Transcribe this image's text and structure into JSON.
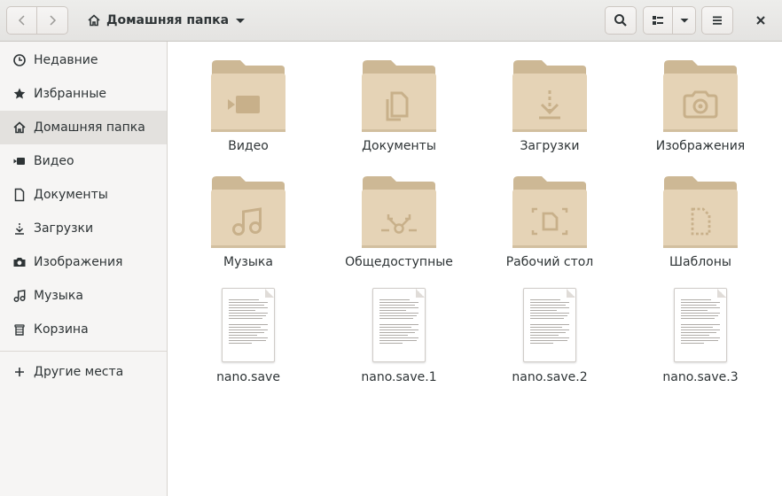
{
  "header": {
    "location_label": "Домашняя папка"
  },
  "sidebar": {
    "items": [
      {
        "label": "Недавние",
        "icon": "clock-icon"
      },
      {
        "label": "Избранные",
        "icon": "star-icon"
      },
      {
        "label": "Домашняя папка",
        "icon": "home-icon",
        "selected": true
      },
      {
        "label": "Видео",
        "icon": "video-icon"
      },
      {
        "label": "Документы",
        "icon": "document-icon"
      },
      {
        "label": "Загрузки",
        "icon": "download-icon"
      },
      {
        "label": "Изображения",
        "icon": "camera-icon"
      },
      {
        "label": "Музыка",
        "icon": "music-icon"
      },
      {
        "label": "Корзина",
        "icon": "trash-icon"
      }
    ],
    "other_places": "Другие места"
  },
  "files": [
    {
      "name": "Видео",
      "kind": "folder",
      "emblem": "video-emblem"
    },
    {
      "name": "Документы",
      "kind": "folder",
      "emblem": "documents-emblem"
    },
    {
      "name": "Загрузки",
      "kind": "folder",
      "emblem": "download-emblem"
    },
    {
      "name": "Изображения",
      "kind": "folder",
      "emblem": "camera-emblem"
    },
    {
      "name": "Музыка",
      "kind": "folder",
      "emblem": "music-emblem"
    },
    {
      "name": "Общедоступные",
      "kind": "folder",
      "emblem": "share-emblem"
    },
    {
      "name": "Рабочий стол",
      "kind": "folder",
      "emblem": "desktop-emblem"
    },
    {
      "name": "Шаблоны",
      "kind": "folder",
      "emblem": "templates-emblem"
    },
    {
      "name": "nano.save",
      "kind": "text-file"
    },
    {
      "name": "nano.save.1",
      "kind": "text-file"
    },
    {
      "name": "nano.save.2",
      "kind": "text-file"
    },
    {
      "name": "nano.save.3",
      "kind": "text-file"
    }
  ],
  "colors": {
    "folder_body": "#e5d3b6",
    "folder_tab": "#cdb895",
    "folder_emblem": "#c8b08a",
    "sidebar_bg": "#f6f5f4",
    "selected_bg": "#e3e1de"
  }
}
